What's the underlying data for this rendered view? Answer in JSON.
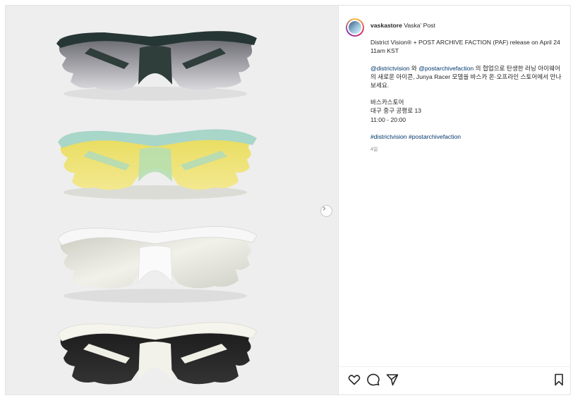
{
  "post": {
    "username": "vaskastore",
    "title_suffix": "Vaska' Post",
    "caption_line1": "District Vision® + POST ARCHIVE FACTION (PAF) release on April 24 11am KST",
    "mention1": "@districtvision",
    "text_wa": " 와 ",
    "mention2": "@postarchivefaction",
    "caption_korean": " 의 협업으로 탄생한 러닝 아이웨어의 새로운 아이콘, Junya Racer 모델을 바스카 온·오프라인 스토어에서 만나보세요.",
    "store_name": "바스카스토어",
    "store_address": "대구 중구 공평로 13",
    "store_hours": "11:00 - 20:00",
    "hashtag1": "#districtvision",
    "hashtag2": "#postarchivefaction",
    "time_ago": "4일"
  },
  "icons": {
    "like": "heart-icon",
    "comment": "comment-icon",
    "share": "send-icon",
    "save": "bookmark-icon",
    "next": "chevron-right-icon"
  },
  "colors": {
    "link": "#00376b",
    "muted": "#8e8e8e",
    "photo_bg": "#eeeeee"
  }
}
